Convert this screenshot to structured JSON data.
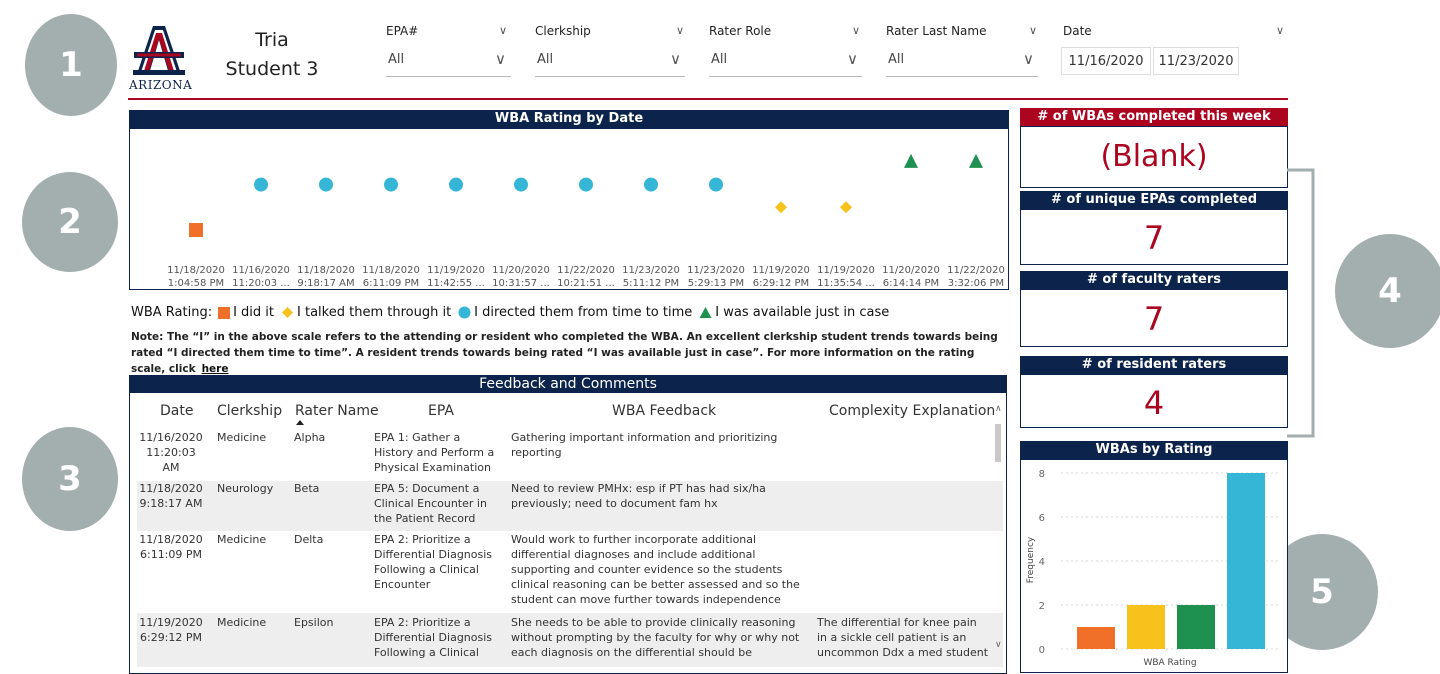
{
  "callouts": [
    "1",
    "2",
    "3",
    "4",
    "5"
  ],
  "logo": {
    "text": "ARIZONA",
    "icon": "university-a-logo"
  },
  "student": {
    "line1": "Tria",
    "line2": "Student 3"
  },
  "filters": [
    {
      "title": "EPA#",
      "value": "All"
    },
    {
      "title": "Clerkship",
      "value": "All"
    },
    {
      "title": "Rater Role",
      "value": "All"
    },
    {
      "title": "Rater Last Name",
      "value": "All"
    }
  ],
  "date_filter": {
    "title": "Date",
    "start": "11/16/2020",
    "end": "11/23/2020"
  },
  "colors": {
    "navy": "#0c234b",
    "red": "#ab0520",
    "did_it": "#f07029",
    "talked": "#f8c21c",
    "directed": "#35b6d7",
    "available": "#1e9050",
    "callout": "#a3aeae"
  },
  "rating_chart": {
    "title": "WBA Rating by Date",
    "chart_data": {
      "type": "scatter",
      "x": [
        "11/18/2020 1:04:58 PM",
        "11/16/2020 11:20:03 ...",
        "11/18/2020 9:18:17 AM",
        "11/18/2020 6:11:09 PM",
        "11/19/2020 11:42:55 ...",
        "11/20/2020 10:31:57 ...",
        "11/22/2020 10:21:51 ...",
        "11/23/2020 5:11:12 PM",
        "11/23/2020 5:29:13 PM",
        "11/19/2020 6:29:12 PM",
        "11/19/2020 11:35:54 ...",
        "11/20/2020 6:14:14 PM",
        "11/22/2020 3:32:06 PM"
      ],
      "x_line1": [
        "11/18/2020",
        "11/16/2020",
        "11/18/2020",
        "11/18/2020",
        "11/19/2020",
        "11/20/2020",
        "11/22/2020",
        "11/23/2020",
        "11/23/2020",
        "11/19/2020",
        "11/19/2020",
        "11/20/2020",
        "11/22/2020"
      ],
      "x_line2": [
        "1:04:58 PM",
        "11:20:03 ...",
        "9:18:17 AM",
        "6:11:09 PM",
        "11:42:55 ...",
        "10:31:57 ...",
        "10:21:51 ...",
        "5:11:12 PM",
        "5:29:13 PM",
        "6:29:12 PM",
        "11:35:54 ...",
        "6:14:14 PM",
        "3:32:06 PM"
      ],
      "y": [
        1,
        3,
        3,
        3,
        3,
        3,
        3,
        3,
        3,
        2,
        2,
        4,
        4
      ],
      "ylim": [
        1,
        4
      ],
      "categories": [
        "I did it",
        "I talked them through it",
        "I directed them from time to time",
        "I was available just in case"
      ],
      "markers": [
        "square",
        "diamond",
        "circle",
        "triangle"
      ],
      "grid": false
    }
  },
  "legend": {
    "label": "WBA Rating:",
    "items": [
      "I did it",
      "I talked them through it",
      "I directed them from time to time",
      "I was available just in case"
    ]
  },
  "note": {
    "text": "Note: The “I” in the above scale refers to the attending or resident who completed the WBA. An excellent clerkship student trends towards being rated “I directed them time to time”. A resident trends towards being rated “I was available just in case”. For more information on the rating scale, click",
    "link": "here"
  },
  "feedback": {
    "title": "Feedback and Comments",
    "columns": [
      "Date",
      "Clerkship",
      "Rater Name",
      "EPA",
      "WBA Feedback",
      "Complexity Explanation"
    ],
    "rows": [
      {
        "date": "11/16/2020 11:20:03 AM",
        "clerkship": "Medicine",
        "rater": "Alpha",
        "epa": "EPA 1: Gather a History and Perform a Physical Examination",
        "feedback": "Gathering important information and prioritizing reporting",
        "complexity": ""
      },
      {
        "date": "11/18/2020 9:18:17 AM",
        "clerkship": "Neurology",
        "rater": "Beta",
        "epa": "EPA 5: Document a Clinical Encounter in the Patient Record",
        "feedback": "Need to review PMHx: esp if PT has had six/ha previously; need to document fam hx",
        "complexity": ""
      },
      {
        "date": "11/18/2020 6:11:09 PM",
        "clerkship": "Medicine",
        "rater": "Delta",
        "epa": "EPA 2: Prioritize a Differential Diagnosis Following a Clinical Encounter",
        "feedback": "Would work to further incorporate additional differential diagnoses and include additional supporting and counter evidence so the students clinical reasoning can be better assessed and so the student can move further towards independence",
        "complexity": ""
      },
      {
        "date": "11/19/2020 6:29:12 PM",
        "clerkship": "Medicine",
        "rater": "Epsilon",
        "epa": "EPA 2: Prioritize a Differential Diagnosis Following a Clinical",
        "feedback": "She needs to be able to provide clinically reasoning without prompting by the faculty for why or why not each diagnosis on the differential should be",
        "complexity": "The differential for knee pain in a sickle cell patient is an uncommon Ddx a med student"
      }
    ]
  },
  "kpis": [
    {
      "title": "# of WBAs completed this week",
      "value": "(Blank)"
    },
    {
      "title": "# of unique EPAs completed",
      "value": "7"
    },
    {
      "title": "# of faculty raters",
      "value": "7"
    },
    {
      "title": "# of resident raters",
      "value": "4"
    }
  ],
  "bar_chart": {
    "title": "WBAs by Rating",
    "chart_data": {
      "type": "bar",
      "categories": [
        "I did it",
        "I talked them through it",
        "I directed them from time to time",
        "I was available just in case"
      ],
      "values": [
        1,
        2,
        2,
        8
      ],
      "xlabel": "WBA Rating",
      "ylabel": "Frequency",
      "ylim": [
        0,
        8
      ],
      "yticks": [
        "0",
        "2",
        "4",
        "6",
        "8"
      ],
      "grid": true
    }
  }
}
